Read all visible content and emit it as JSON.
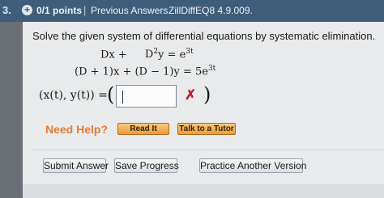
{
  "header": {
    "question_number": "3.",
    "points": "0/1 points",
    "separator": "|",
    "previous_answers": "Previous Answers",
    "question_id": "ZillDiffEQ8 4.9.009."
  },
  "problem": {
    "prompt": "Solve the given system of differential equations by systematic elimination.",
    "eq1_left": "Dx +",
    "eq1_right_base": "D",
    "eq1_right_exp": "2",
    "eq1_right_rest": "y = e",
    "eq1_rhs_exp": "3t",
    "eq2_text": "(D + 1)x + (D − 1)y = 5e",
    "eq2_exp": "3t"
  },
  "answer": {
    "label": "(x(t), y(t)) =",
    "open_paren": "(",
    "close_paren": ")",
    "input_value": "",
    "status": "✗"
  },
  "help": {
    "label": "Need Help?",
    "read_button": "Read It",
    "tutor_button": "Talk to a Tutor"
  },
  "actions": {
    "submit": "Submit Answer",
    "save": "Save Progress",
    "practice": "Practice Another Version"
  },
  "colors": {
    "header_bg": "#3e5d7a",
    "error_red": "#c21f2f",
    "help_orange": "#e47d35"
  }
}
